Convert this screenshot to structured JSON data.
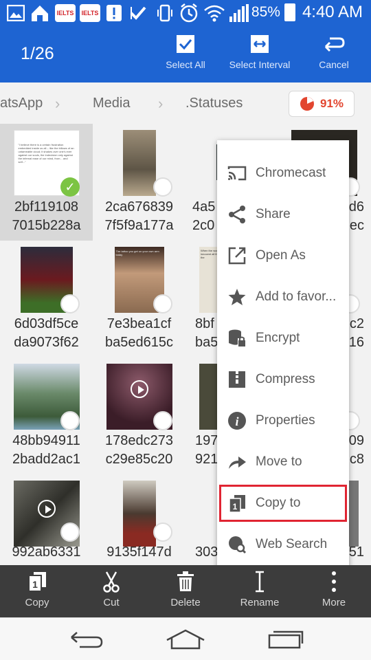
{
  "status_bar": {
    "battery": "85%",
    "time": "4:40 AM",
    "ielts_label": "IELTS"
  },
  "action_bar": {
    "counter": "1/26",
    "buttons": [
      {
        "label": "Select All",
        "icon": "check-box-icon"
      },
      {
        "label": "Select Interval",
        "icon": "interval-icon"
      },
      {
        "label": "Cancel",
        "icon": "undo-icon"
      }
    ]
  },
  "breadcrumb": {
    "items": [
      "atsApp",
      "Media",
      ".Statuses"
    ],
    "storage": "91%"
  },
  "files": [
    {
      "line1": "2bf119108",
      "line2": "7015b228a",
      "selected": true
    },
    {
      "line1": "2ca676839",
      "line2": "7f5f9a177a"
    },
    {
      "line1": "4a5",
      "line2": "2c0"
    },
    {
      "line1": "d6",
      "line2": "ec"
    },
    {
      "line1": "6d03df5ce",
      "line2": "da9073f62"
    },
    {
      "line1": "7e3bea1cf",
      "line2": "ba5ed615c"
    },
    {
      "line1": "8bf",
      "line2": "ba5"
    },
    {
      "line1": "c2",
      "line2": "16"
    },
    {
      "line1": "48bb94911",
      "line2": "2badd2ac1"
    },
    {
      "line1": "178edc273",
      "line2": "c29e85c20"
    },
    {
      "line1": "197",
      "line2": "921"
    },
    {
      "line1": "09",
      "line2": "c8"
    },
    {
      "line1": "992ab6331",
      "line2": ""
    },
    {
      "line1": "9135f147d",
      "line2": ""
    },
    {
      "line1": "303",
      "line2": ""
    },
    {
      "line1": "51",
      "line2": ""
    }
  ],
  "thumb_texts": {
    "quote": "\"I believe there is a certain frustration embedded inside us all – like the billows of an untameable cloud; it shakes over one's ever against our souls, the indecision only against the infernal ease of our mind, from... and self...\"",
    "caption": "The tattoo you get on your own arm today",
    "meme": "When the work is innocent all the working the"
  },
  "menu": {
    "items": [
      {
        "label": "Chromecast",
        "icon": "cast-icon"
      },
      {
        "label": "Share",
        "icon": "share-icon"
      },
      {
        "label": "Open As",
        "icon": "open-external-icon"
      },
      {
        "label": "Add to favor...",
        "icon": "star-icon"
      },
      {
        "label": "Encrypt",
        "icon": "lock-database-icon"
      },
      {
        "label": "Compress",
        "icon": "archive-icon"
      },
      {
        "label": "Properties",
        "icon": "info-icon"
      },
      {
        "label": "Move to",
        "icon": "move-arrow-icon"
      },
      {
        "label": "Copy to",
        "icon": "copy-to-icon",
        "highlighted": true
      },
      {
        "label": "Web Search",
        "icon": "web-search-icon"
      }
    ]
  },
  "toolbar": {
    "buttons": [
      {
        "label": "Copy",
        "icon": "copy-icon"
      },
      {
        "label": "Cut",
        "icon": "scissors-icon"
      },
      {
        "label": "Delete",
        "icon": "trash-icon"
      },
      {
        "label": "Rename",
        "icon": "rename-cursor-icon"
      },
      {
        "label": "More",
        "icon": "more-vertical-icon"
      }
    ]
  },
  "colors": {
    "accent": "#1e64d2",
    "toolbar_bg": "#3c3c3c",
    "highlight": "#e02432",
    "check_green": "#7cc443",
    "storage_red": "#e2452f"
  }
}
